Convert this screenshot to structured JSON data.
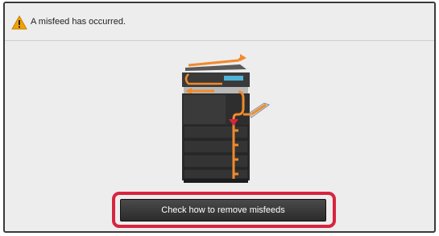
{
  "alert": {
    "message": "A misfeed has occurred.",
    "icon": "warning-icon"
  },
  "illustration": {
    "icon": "copier-misfeed-diagram"
  },
  "action": {
    "button_label": "Check how to remove misfeeds"
  },
  "colors": {
    "highlight": "#d8243f",
    "paper_path": "#f08a2c",
    "machine_body": "#2e2e2e",
    "display_panel": "#4fb3d6",
    "warning": "#f2a200"
  }
}
